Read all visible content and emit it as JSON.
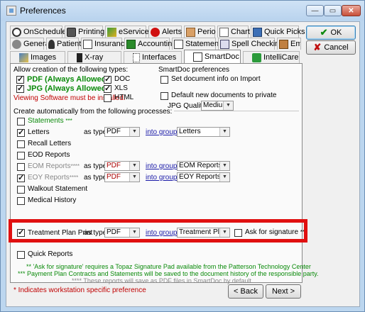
{
  "window": {
    "title": "Preferences",
    "min": "—",
    "max": "▭",
    "close": "✕"
  },
  "tabs_row1": [
    {
      "label": "OnSchedule",
      "icon": "onschedule-icon"
    },
    {
      "label": "Printing",
      "icon": "printer-icon"
    },
    {
      "label": "eService",
      "icon": "eservice-icon"
    },
    {
      "label": "Alerts",
      "icon": "alert-icon"
    },
    {
      "label": "Perio",
      "icon": "perio-icon"
    },
    {
      "label": "Chart",
      "icon": "chart-icon"
    },
    {
      "label": "Quick Picks",
      "icon": "quick-picks-icon"
    }
  ],
  "tabs_row2": [
    {
      "label": "General",
      "icon": "general-icon"
    },
    {
      "label": "Patient",
      "icon": "patient-icon"
    },
    {
      "label": "Insurance",
      "icon": "insurance-icon"
    },
    {
      "label": "Accounting",
      "icon": "accounting-icon"
    },
    {
      "label": "Statements",
      "icon": "statements-icon"
    },
    {
      "label": "Spell Checking",
      "icon": "spell-check-icon"
    },
    {
      "label": "Employer",
      "icon": "employer-icon"
    }
  ],
  "tabs_row3": [
    {
      "label": "Images",
      "icon": "images-icon"
    },
    {
      "label": "X-ray",
      "icon": "xray-icon"
    },
    {
      "label": "Interfaces",
      "icon": "interfaces-icon"
    },
    {
      "label": "SmartDoc",
      "icon": "smartdoc-icon",
      "active": true
    },
    {
      "label": "IntelliCare",
      "icon": "intellicare-icon"
    }
  ],
  "buttons": {
    "ok": "OK",
    "cancel": "Cancel",
    "back": "< Back",
    "next": "Next >"
  },
  "types": {
    "heading": "Allow creation of the following types:",
    "pdf": "PDF (Always Allowed)",
    "jpg": "JPG (Always Allowed)",
    "viewing_note": "Viewing Software must be installed.",
    "doc": "DOC",
    "xls": "XLS",
    "html": "HTML"
  },
  "smartdoc_prefs": {
    "heading": "SmartDoc preferences",
    "set_info": "Set document info on Import",
    "default_private": "Default new documents to private",
    "jpg_quality_label": "JPG Quality:",
    "jpg_quality_value": "Medium"
  },
  "processes": {
    "heading": "Create automatically from the following processes:",
    "as_type": "as type",
    "into_group": "into group",
    "ask_signature": "Ask for signature",
    "ask_signature_mark": "**",
    "rows": [
      {
        "label": "Statements",
        "mark": "***",
        "checked": false,
        "style": "green"
      },
      {
        "label": "Letters",
        "checked": true,
        "type": "PDF",
        "group": "Letters"
      },
      {
        "label": "Recall Letters",
        "checked": false
      },
      {
        "label": "EOD Reports",
        "checked": false
      },
      {
        "label": "EOM Reports",
        "mark": "****",
        "checked": false,
        "type": "PDF",
        "group": "EOM Reports",
        "style": "gray"
      },
      {
        "label": "EOY Reports",
        "mark": "****",
        "checked": true,
        "type": "PDF",
        "group": "EOY Reports",
        "style": "gray"
      },
      {
        "label": "Walkout Statement",
        "checked": false
      },
      {
        "label": "Medical History",
        "checked": false
      },
      {
        "label": "Treatment Plan Print",
        "checked": true,
        "type": "PDF",
        "group": "Treatment Plans"
      },
      {
        "label": "Quick Reports",
        "checked": false
      }
    ]
  },
  "notes": {
    "line1": "** 'Ask for signature' requires a Topaz Signature Pad available from the Patterson Technology Center",
    "line2": "*** Payment Plan Contracts and Statements will be saved to the document history of the responsible party.",
    "line3": "**** These reports will save as PDF files in SmartDoc by default."
  },
  "footer_note": "* Indicates workstation specific preference",
  "colors": {
    "highlight": "#e01010",
    "green_text": "#0a8a0a",
    "red_text": "#c00000",
    "link": "#1a1aa8"
  }
}
